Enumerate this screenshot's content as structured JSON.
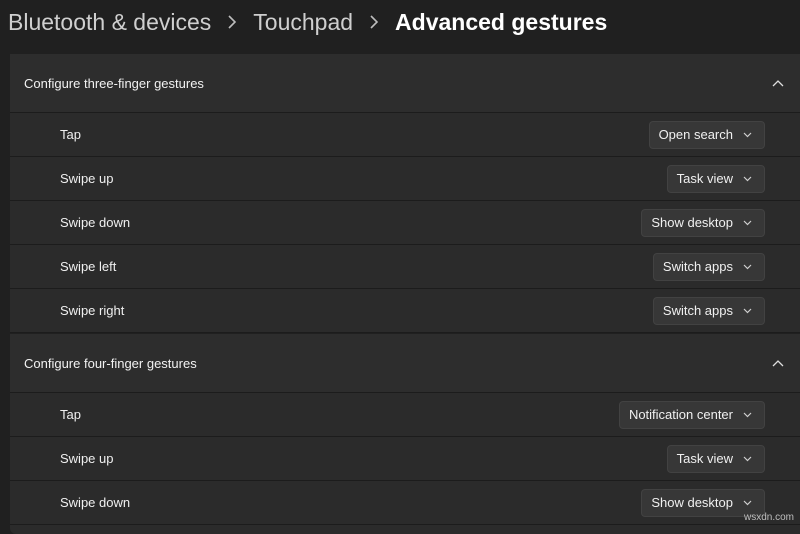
{
  "breadcrumb": {
    "items": [
      "Bluetooth & devices",
      "Touchpad",
      "Advanced gestures"
    ]
  },
  "three_finger": {
    "title": "Configure three-finger gestures",
    "rows": [
      {
        "label": "Tap",
        "value": "Open search"
      },
      {
        "label": "Swipe up",
        "value": "Task view"
      },
      {
        "label": "Swipe down",
        "value": "Show desktop"
      },
      {
        "label": "Swipe left",
        "value": "Switch apps"
      },
      {
        "label": "Swipe right",
        "value": "Switch apps"
      }
    ]
  },
  "four_finger": {
    "title": "Configure four-finger gestures",
    "rows": [
      {
        "label": "Tap",
        "value": "Notification center"
      },
      {
        "label": "Swipe up",
        "value": "Task view"
      },
      {
        "label": "Swipe down",
        "value": "Show desktop"
      }
    ]
  },
  "watermark": "wsxdn.com",
  "colors": {
    "background": "#202020",
    "card": "#2b2b2b",
    "dropdown": "#373737"
  }
}
